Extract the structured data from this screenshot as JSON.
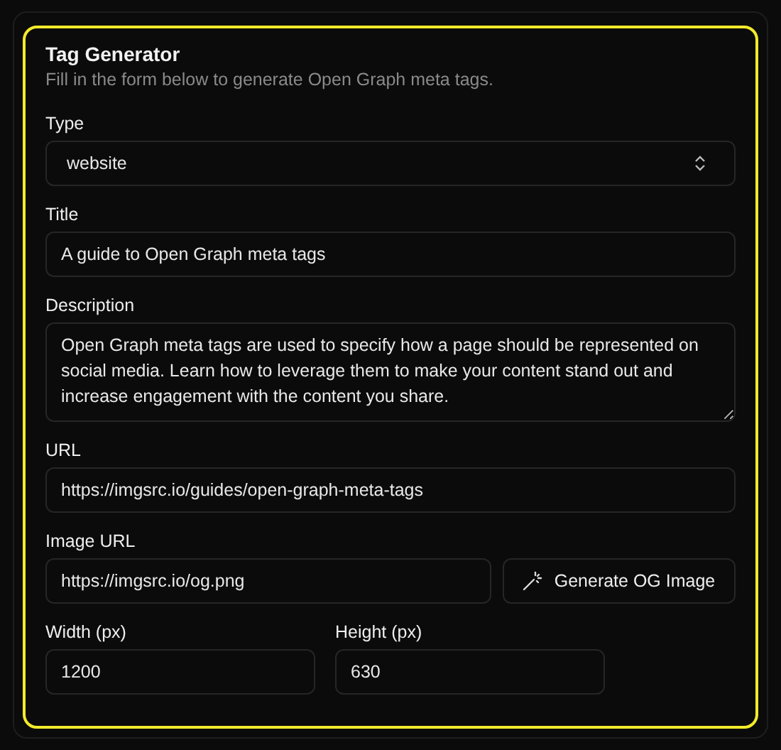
{
  "card": {
    "title": "Tag Generator",
    "subtitle": "Fill in the form below to generate Open Graph meta tags."
  },
  "type_field": {
    "label": "Type",
    "value": "website"
  },
  "title_field": {
    "label": "Title",
    "value": "A guide to Open Graph meta tags"
  },
  "description_field": {
    "label": "Description",
    "value": "Open Graph meta tags are used to specify how a page should be represented on social media. Learn how to leverage them to make your content stand out and increase engagement with the content you share."
  },
  "url_field": {
    "label": "URL",
    "value": "https://imgsrc.io/guides/open-graph-meta-tags"
  },
  "image_url_field": {
    "label": "Image URL",
    "value": "https://imgsrc.io/og.png"
  },
  "generate_button": {
    "label": "Generate OG Image"
  },
  "width_field": {
    "label": "Width (px)",
    "value": "1200"
  },
  "height_field": {
    "label": "Height (px)",
    "value": "630"
  }
}
